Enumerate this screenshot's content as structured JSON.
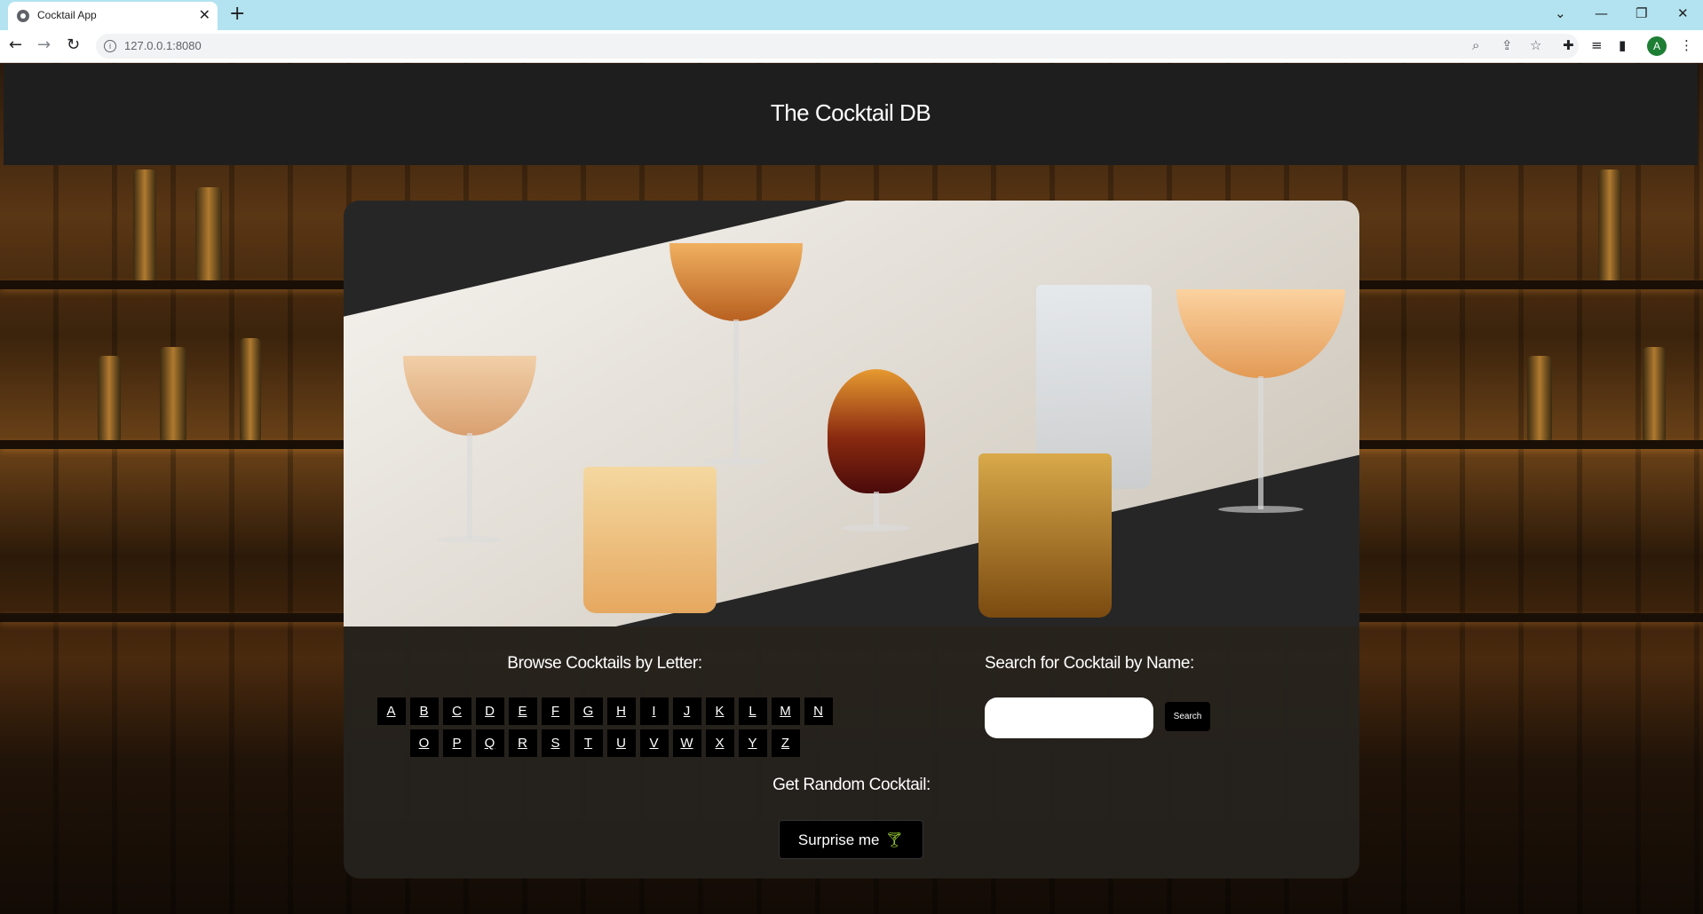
{
  "browser": {
    "tab_title": "Cocktail App",
    "url": "127.0.0.1:8080",
    "avatar_letter": "A"
  },
  "header": {
    "title": "The Cocktail DB"
  },
  "browse": {
    "title": "Browse Cocktails by Letter:",
    "row1": [
      "A",
      "B",
      "C",
      "D",
      "E",
      "F",
      "G",
      "H",
      "I",
      "J",
      "K",
      "L",
      "M",
      "N"
    ],
    "row2": [
      "O",
      "P",
      "Q",
      "R",
      "S",
      "T",
      "U",
      "V",
      "W",
      "X",
      "Y",
      "Z"
    ]
  },
  "search": {
    "title": "Search for Cocktail by Name:",
    "input_value": "",
    "button_label": "Search"
  },
  "random": {
    "title": "Get Random Cocktail:",
    "button_label": "Surprise me",
    "icon": "martini-icon"
  },
  "colors": {
    "header_bg": "#1e1e1e",
    "card_bg": "#262626",
    "button_bg": "#000000",
    "accent_icon": "#9acd32",
    "tabbar": "#b3e3f0"
  }
}
